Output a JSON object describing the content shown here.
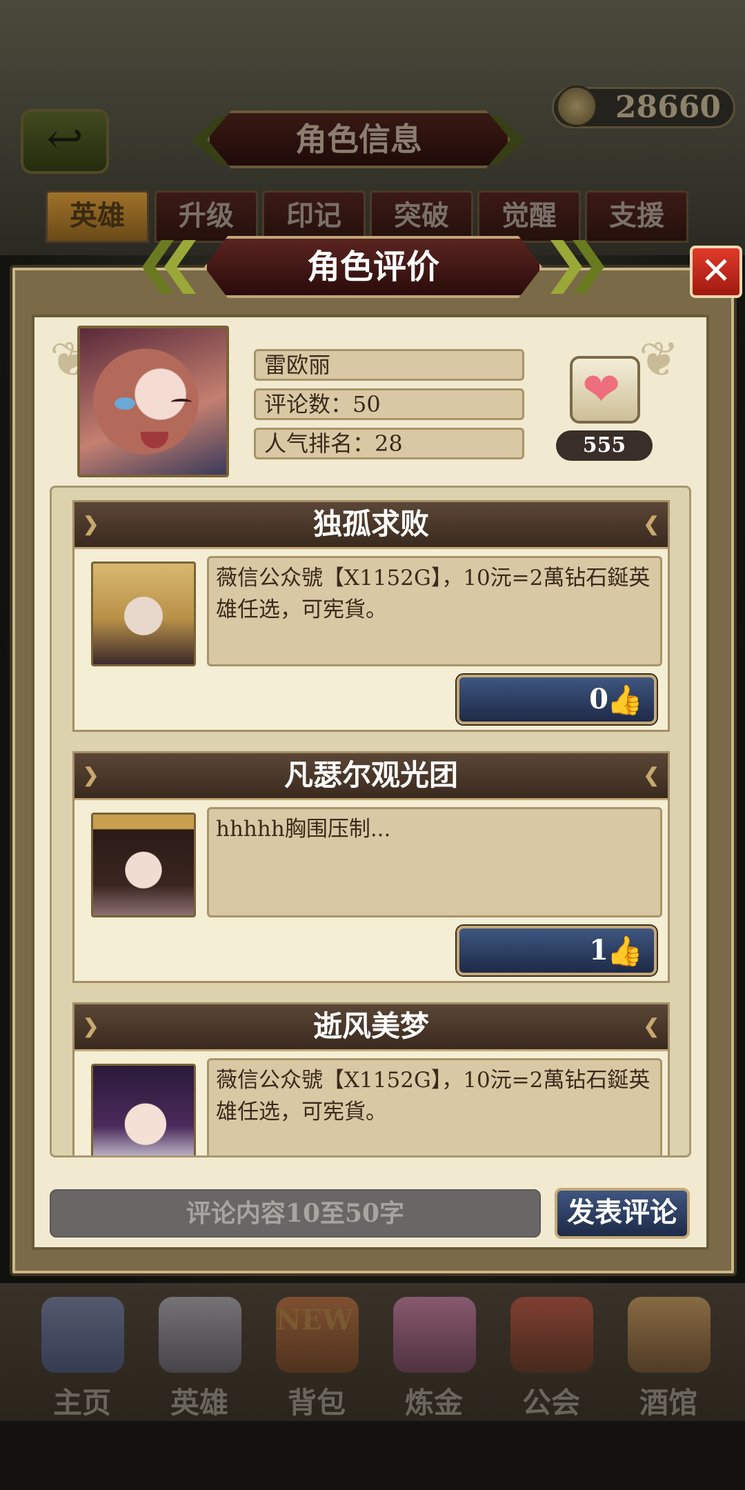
{
  "currency": {
    "amount": "28660"
  },
  "header": {
    "title": "角色信息",
    "back_icon": "↩"
  },
  "tabs": [
    {
      "label": "英雄",
      "active": true
    },
    {
      "label": "升级"
    },
    {
      "label": "印记"
    },
    {
      "label": "突破"
    },
    {
      "label": "觉醒"
    },
    {
      "label": "支援"
    }
  ],
  "modal": {
    "title": "角色评价",
    "close_glyph": "✕",
    "hero": {
      "name": "雷欧丽",
      "comment_count": "评论数：50",
      "rank": "人气排名：28",
      "like_count": "555",
      "heart_glyph": "❤"
    },
    "comments": [
      {
        "author": "独孤求败",
        "text": "薇信公众號【X1152G】，10沅=2萬钻石鋋英雄任选，可宪貨。",
        "likes": "0"
      },
      {
        "author": "凡瑟尔观光团",
        "text": "hhhhh胸围压制...",
        "likes": "1"
      },
      {
        "author": "逝风美梦",
        "text": "薇信公众號【X1152G】，10沅=2萬钻石鋋英雄任选，可宪貨。",
        "likes": ""
      }
    ],
    "thumb_glyph": "👍",
    "input_placeholder": "评论内容10至50字",
    "post_label": "发表评论"
  },
  "bottom_nav": [
    {
      "label": "主页"
    },
    {
      "label": "英雄"
    },
    {
      "label": "背包",
      "badge": "NEW"
    },
    {
      "label": "炼金"
    },
    {
      "label": "公会"
    },
    {
      "label": "酒馆"
    }
  ],
  "colors": {
    "panel_bg": "#f1ead0",
    "header_brown": "#3a2a1e",
    "button_blue": "#1e2a48",
    "close_red": "#e03a2a",
    "heart_pink": "#ee6e7e"
  }
}
